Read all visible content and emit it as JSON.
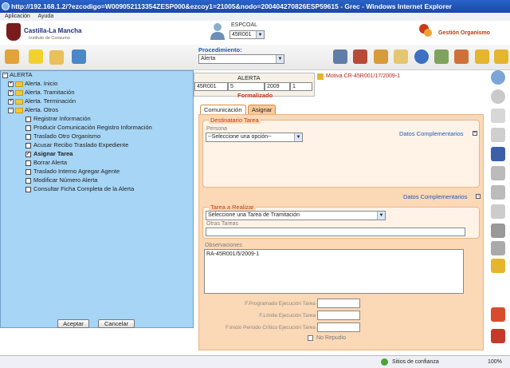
{
  "window": {
    "title": "http://192.168.1.2/?ezcodigo=W009052113354ZESP000&ezcoy1=21005&nodo=200404270826ESP59615 - Grec - Windows Internet Explorer"
  },
  "menu": {
    "items": [
      "Aplicación",
      "Ayuda"
    ]
  },
  "header": {
    "logo_title": "Castilla-La Mancha",
    "logo_subtitle": "Instituto de Consumo",
    "user_name": "ESPCOAL",
    "user_select": "45R001",
    "gestion": "Gestión Organismo"
  },
  "procedimiento": {
    "label": "Procedimiento:",
    "value": "Alerta"
  },
  "alerta": {
    "title": "ALERTA",
    "fields": [
      "45R001",
      "5",
      "2009",
      "1"
    ],
    "status": "Formalizado",
    "motiva": "Motiva CR-45R001/17/2009-1"
  },
  "tabs": [
    "Comunicación",
    "Asignar"
  ],
  "destinatario": {
    "legend": "Destinatario Tarea",
    "persona_label": "Persona",
    "persona_value": "--Seleccione una opción--",
    "datos_complementarios": "Datos Complementarios"
  },
  "datos_complementarios_2": "Datos Complementarios",
  "tarea": {
    "legend": "Tarea a Realizar",
    "select_value": "Seleccione una Tarea de Tramitación",
    "otras_label": "Otras Tareas"
  },
  "observaciones": {
    "label": "Observaciones",
    "value": "RA-45R001/5/2009-1"
  },
  "dates": {
    "programado": "F.Programado Ejecución Tarea",
    "limite": "F.Límite Ejecución Tarea",
    "inicio": "F.Inicio Periodo Crítico Ejecución Tarea",
    "no_repudio": "No Repudio"
  },
  "tree": {
    "root": "ALERTA",
    "folders": [
      "Alerta. Inicio",
      "Alerta. Tramitación",
      "Alerta. Terminación",
      "Alerta. Otros"
    ],
    "items": [
      {
        "label": "Registrar Información",
        "checked": false
      },
      {
        "label": "Producir Comunicación Registro Información",
        "checked": false
      },
      {
        "label": "Traslado Otro Organismo",
        "checked": false
      },
      {
        "label": "Acusar Recibo Traslado Expediente",
        "checked": false
      },
      {
        "label": "Asignar Tarea",
        "checked": true
      },
      {
        "label": "Borrar Alerta",
        "checked": false
      },
      {
        "label": "Traslado Interno Agregar Agente",
        "checked": false
      },
      {
        "label": "Modificar Número Alerta",
        "checked": false
      },
      {
        "label": "Consultar Ficha Completa de la Alerta",
        "checked": false
      }
    ],
    "accept": "Aceptar",
    "cancel": "Cancelar"
  },
  "status": {
    "zone": "Sitios de confianza",
    "zoom": "100%"
  },
  "colors": {
    "accent": "#1f57b8",
    "panel": "#fbd8b6",
    "tree": "#a6d5f5",
    "alert": "#c8391a"
  }
}
